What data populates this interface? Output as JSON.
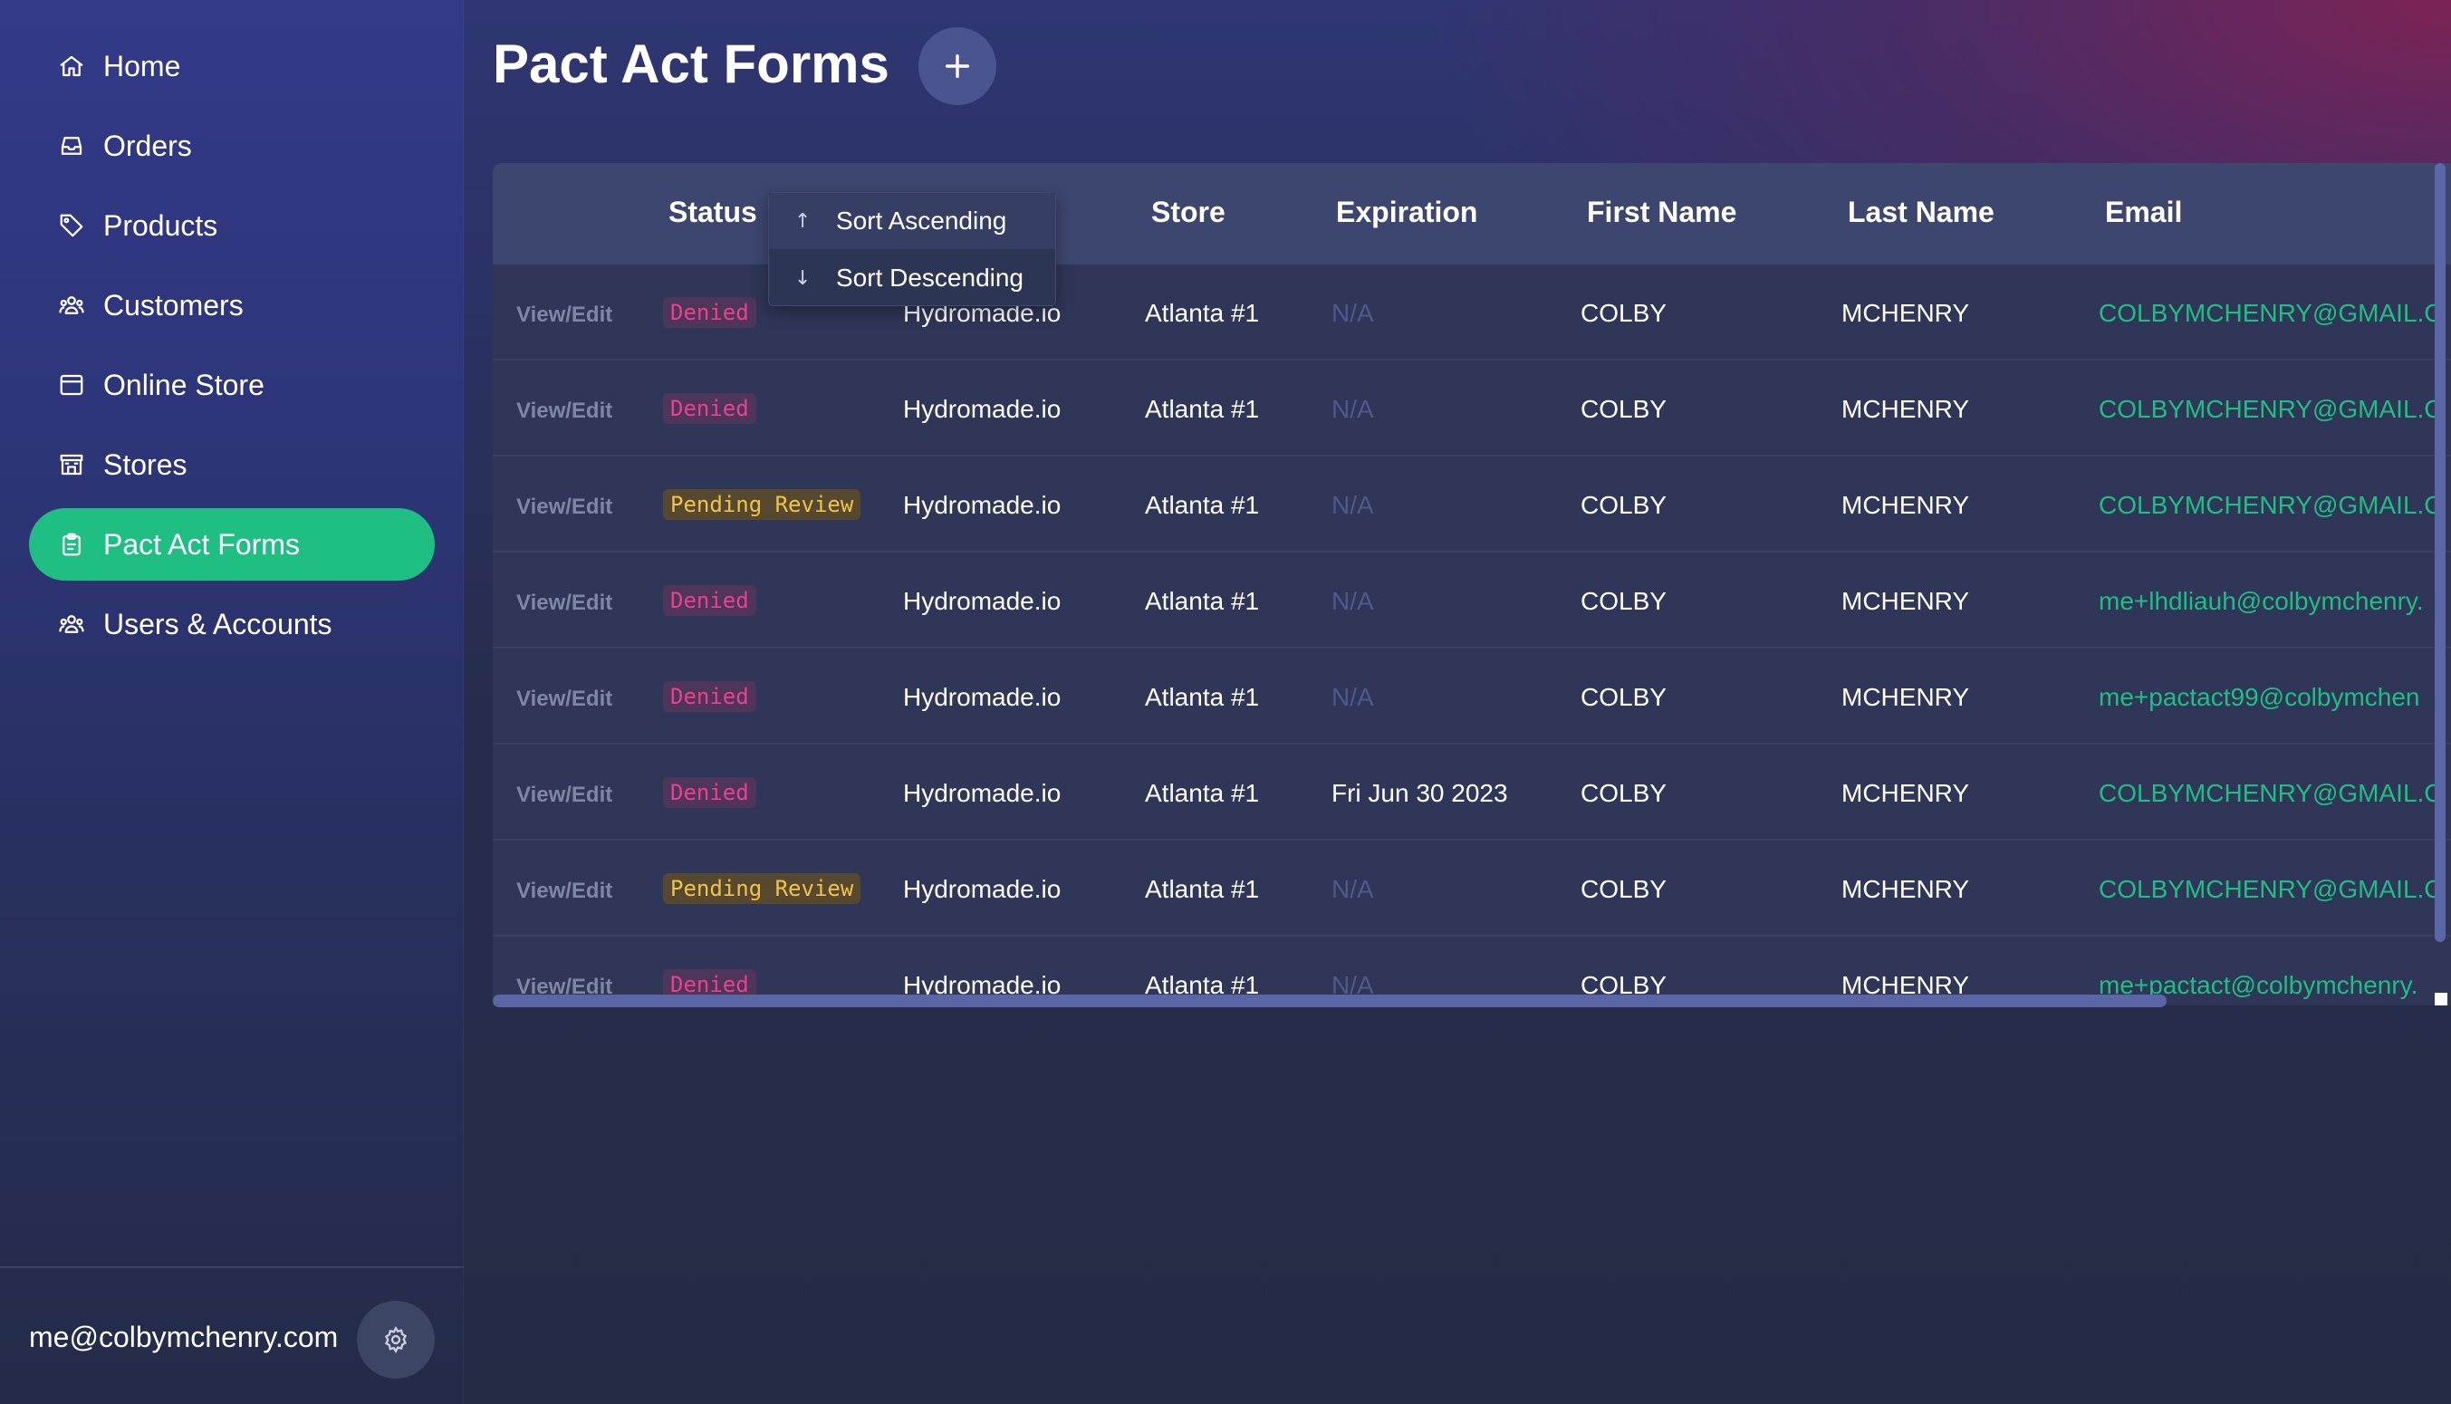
{
  "sidebar": {
    "items": [
      {
        "label": "Home",
        "icon": "home-icon"
      },
      {
        "label": "Orders",
        "icon": "inbox-icon"
      },
      {
        "label": "Products",
        "icon": "tag-icon"
      },
      {
        "label": "Customers",
        "icon": "users-icon"
      },
      {
        "label": "Online Store",
        "icon": "window-icon"
      },
      {
        "label": "Stores",
        "icon": "building-icon"
      },
      {
        "label": "Pact Act Forms",
        "icon": "clipboard-icon",
        "active": true
      },
      {
        "label": "Users & Accounts",
        "icon": "users-icon"
      }
    ],
    "footer": {
      "email": "me@colbymchenry.com",
      "settings_icon": "gear-icon"
    }
  },
  "header": {
    "title": "Pact Act Forms",
    "add_icon": "plus-icon"
  },
  "table": {
    "columns": [
      "Status",
      "Store",
      "Expiration",
      "First Name",
      "Last Name",
      "Email"
    ],
    "rows": [
      {
        "action": "View/Edit",
        "status": "Denied",
        "brand": "Hydromade.io",
        "store": "Atlanta #1",
        "expiration": "N/A",
        "first": "COLBY",
        "last": "MCHENRY",
        "email": "COLBYMCHENRY@GMAIL.C"
      },
      {
        "action": "View/Edit",
        "status": "Denied",
        "brand": "Hydromade.io",
        "store": "Atlanta #1",
        "expiration": "N/A",
        "first": "COLBY",
        "last": "MCHENRY",
        "email": "COLBYMCHENRY@GMAIL.C"
      },
      {
        "action": "View/Edit",
        "status": "Pending Review",
        "brand": "Hydromade.io",
        "store": "Atlanta #1",
        "expiration": "N/A",
        "first": "COLBY",
        "last": "MCHENRY",
        "email": "COLBYMCHENRY@GMAIL.C"
      },
      {
        "action": "View/Edit",
        "status": "Denied",
        "brand": "Hydromade.io",
        "store": "Atlanta #1",
        "expiration": "N/A",
        "first": "COLBY",
        "last": "MCHENRY",
        "email": "me+lhdliauh@colbymchenry."
      },
      {
        "action": "View/Edit",
        "status": "Denied",
        "brand": "Hydromade.io",
        "store": "Atlanta #1",
        "expiration": "N/A",
        "first": "COLBY",
        "last": "MCHENRY",
        "email": "me+pactact99@colbymchen"
      },
      {
        "action": "View/Edit",
        "status": "Denied",
        "brand": "Hydromade.io",
        "store": "Atlanta #1",
        "expiration": "Fri Jun 30 2023",
        "first": "COLBY",
        "last": "MCHENRY",
        "email": "COLBYMCHENRY@GMAIL.C"
      },
      {
        "action": "View/Edit",
        "status": "Pending Review",
        "brand": "Hydromade.io",
        "store": "Atlanta #1",
        "expiration": "N/A",
        "first": "COLBY",
        "last": "MCHENRY",
        "email": "COLBYMCHENRY@GMAIL.C"
      },
      {
        "action": "View/Edit",
        "status": "Denied",
        "brand": "Hydromade.io",
        "store": "Atlanta #1",
        "expiration": "N/A",
        "first": "COLBY",
        "last": "MCHENRY",
        "email": "me+pactact@colbymchenry."
      }
    ]
  },
  "sort_menu": {
    "ascending": "Sort Ascending",
    "descending": "Sort Descending",
    "asc_icon": "arrow-up-icon",
    "desc_icon": "arrow-down-icon"
  },
  "colors": {
    "accent": "#1fbf84",
    "denied": "#ef3f8f",
    "pending": "#f0c44a"
  }
}
